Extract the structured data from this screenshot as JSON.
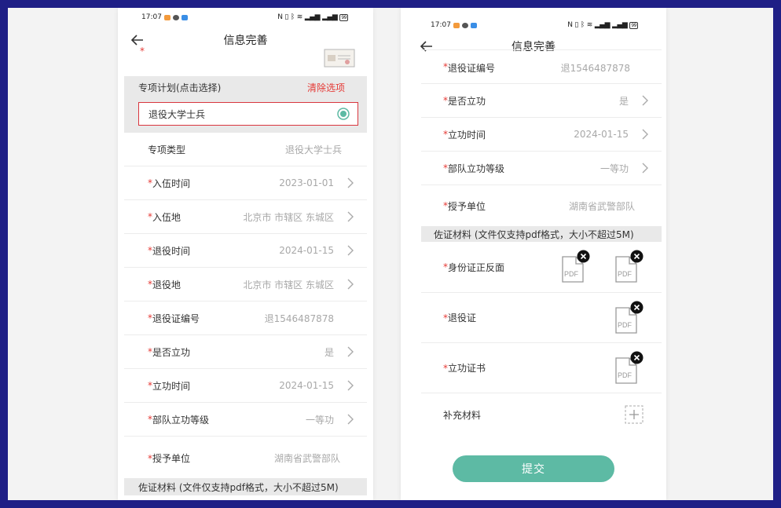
{
  "status": {
    "time": "17:07",
    "battery": "99"
  },
  "nav": {
    "title": "信息完善"
  },
  "plan": {
    "section_label": "专项计划(点击选择)",
    "clear_label": "清除选项",
    "selected_option": "退役大学士兵"
  },
  "fields": {
    "plan_type": {
      "label": "专项类型",
      "value": "退役大学士兵"
    },
    "enlist_time": {
      "label": "入伍时间",
      "value": "2023-01-01"
    },
    "enlist_place": {
      "label": "入伍地",
      "value": "北京市  市辖区  东城区"
    },
    "discharge_time": {
      "label": "退役时间",
      "value": "2024-01-15"
    },
    "discharge_place": {
      "label": "退役地",
      "value": "北京市  市辖区  东城区"
    },
    "cert_number": {
      "label": "退役证编号",
      "value": "退1546487878"
    },
    "has_merit": {
      "label": "是否立功",
      "value": "是"
    },
    "merit_time": {
      "label": "立功时间",
      "value": "2024-01-15"
    },
    "merit_level": {
      "label": "部队立功等级",
      "value": "一等功"
    },
    "award_unit": {
      "label": "授予单位",
      "value": "湖南省武警部队"
    }
  },
  "required_mark": "*",
  "materials": {
    "section_label": "佐证材料 (文件仅支持pdf格式，大小不超过5M)",
    "id_card_label": "身份证正反面",
    "discharge_cert_label": "退役证",
    "merit_cert_label": "立功证书",
    "extra_label": "补充材料",
    "pdf_text": "PDF"
  },
  "submit_label": "提交",
  "colors": {
    "required": "#e53935",
    "accent": "#5dbaa4",
    "selected_border": "#d9363e",
    "section_bg": "#e9e9e9",
    "frame": "#1f1f86"
  }
}
